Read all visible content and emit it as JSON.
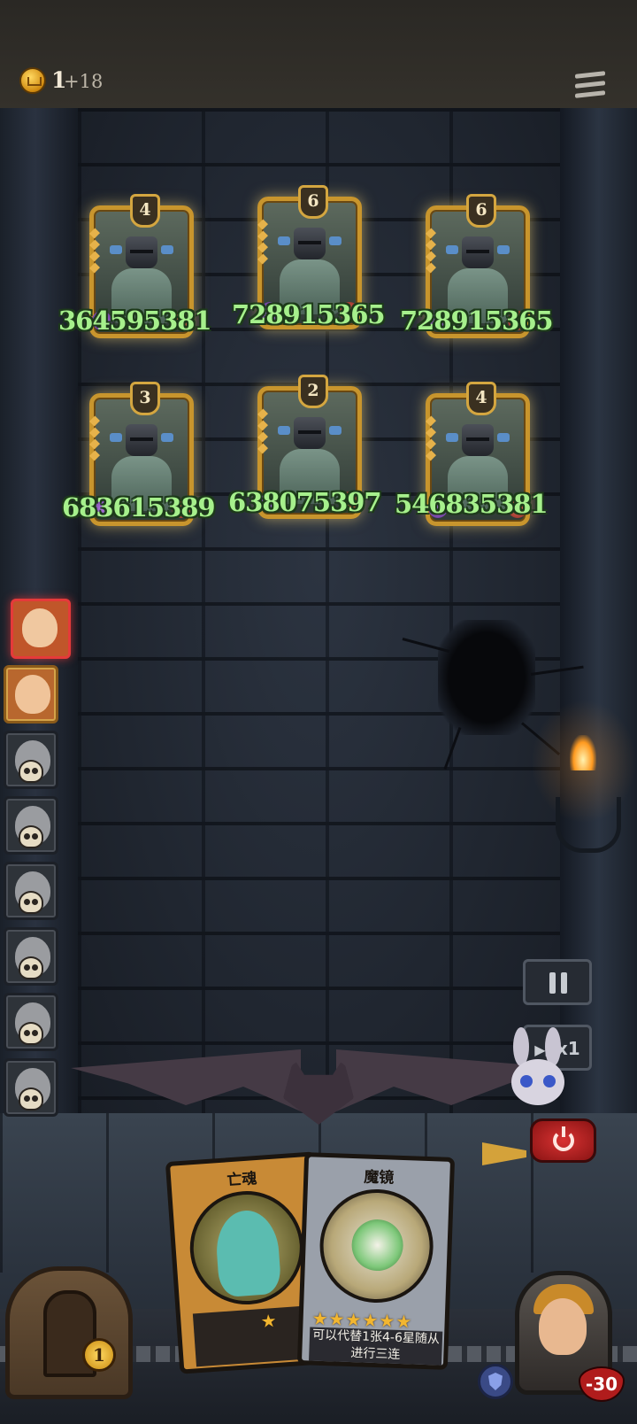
{
  "top_bar": {
    "gold": "1",
    "gold_income": "+18"
  },
  "board": {
    "units": [
      {
        "level": "4",
        "hp": "364595381"
      },
      {
        "level": "6",
        "hp": "728915365"
      },
      {
        "level": "6",
        "hp": "728915365"
      },
      {
        "level": "3",
        "hp": "683615389"
      },
      {
        "level": "2",
        "hp": "638075397"
      },
      {
        "level": "4",
        "hp": "546835381"
      }
    ]
  },
  "heroes": [
    {
      "state": "active"
    },
    {
      "state": "alive"
    },
    {
      "state": "eliminated"
    },
    {
      "state": "eliminated"
    },
    {
      "state": "eliminated"
    },
    {
      "state": "eliminated"
    },
    {
      "state": "eliminated"
    },
    {
      "state": "eliminated"
    }
  ],
  "controls": {
    "speed_label": "x1"
  },
  "shop": {
    "level": "1",
    "cards": [
      {
        "name": "亡魂",
        "stars": 1,
        "description": ""
      },
      {
        "name": "魔镜",
        "stars": 6,
        "description": "可以代替1张4-6星随从进行三连"
      }
    ]
  },
  "player": {
    "health": "-30"
  },
  "colors": {
    "hp_text": "#a6f08c",
    "card_gold_border": "#c8952d",
    "active_hero_border": "#e53a3a",
    "power_button": "#d83232"
  }
}
